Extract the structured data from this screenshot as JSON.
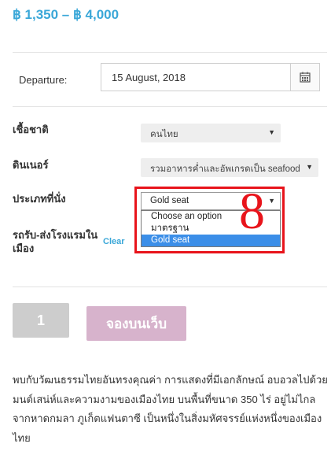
{
  "price_range": "฿ 1,350 – ฿ 4,000",
  "departure": {
    "label": "Departure:",
    "date_value": "15 August, 2018",
    "calendar_icon": "calendar-icon"
  },
  "nationality": {
    "label": "เชื้อชาติ",
    "value": "คนไทย"
  },
  "dinner": {
    "label": "ดินเนอร์",
    "value": "รวมอาหารค่ำและอัพเกรดเป็น seafood"
  },
  "seat": {
    "label": "ประเภทที่นั่ง",
    "value": "Gold seat",
    "options": [
      "Choose an option",
      "มาตรฐาน",
      "Gold seat"
    ],
    "selected_index": 2
  },
  "transfer": {
    "label_line1": "รถรับ-ส่งโรงแรมใน",
    "label_line2": "เมือง",
    "clear_label": "Clear"
  },
  "annotation": "8",
  "quantity": "1",
  "book_button": "จองบนเว็บ",
  "description": "พบกับวัฒนธรรมไทยอันทรงคุณค่า การแสดงที่มีเอกลักษณ์ อบอวลไปด้วยมนต์เสน่ห์และความงามของเมืองไทย บนพื้นที่ขนาด 350 ไร่ อยู่ไม่ไกลจากหาดกมลา ภูเก็ตแฟนตาซี เป็นหนึ่งในสิ่งมหัศจรรย์แห่งหนึ่งของเมืองไทย",
  "colors": {
    "accent": "#3aa7d8",
    "highlight": "#e8141b",
    "book_button": "#d7b3cc",
    "selected_option": "#3b8ee8"
  }
}
